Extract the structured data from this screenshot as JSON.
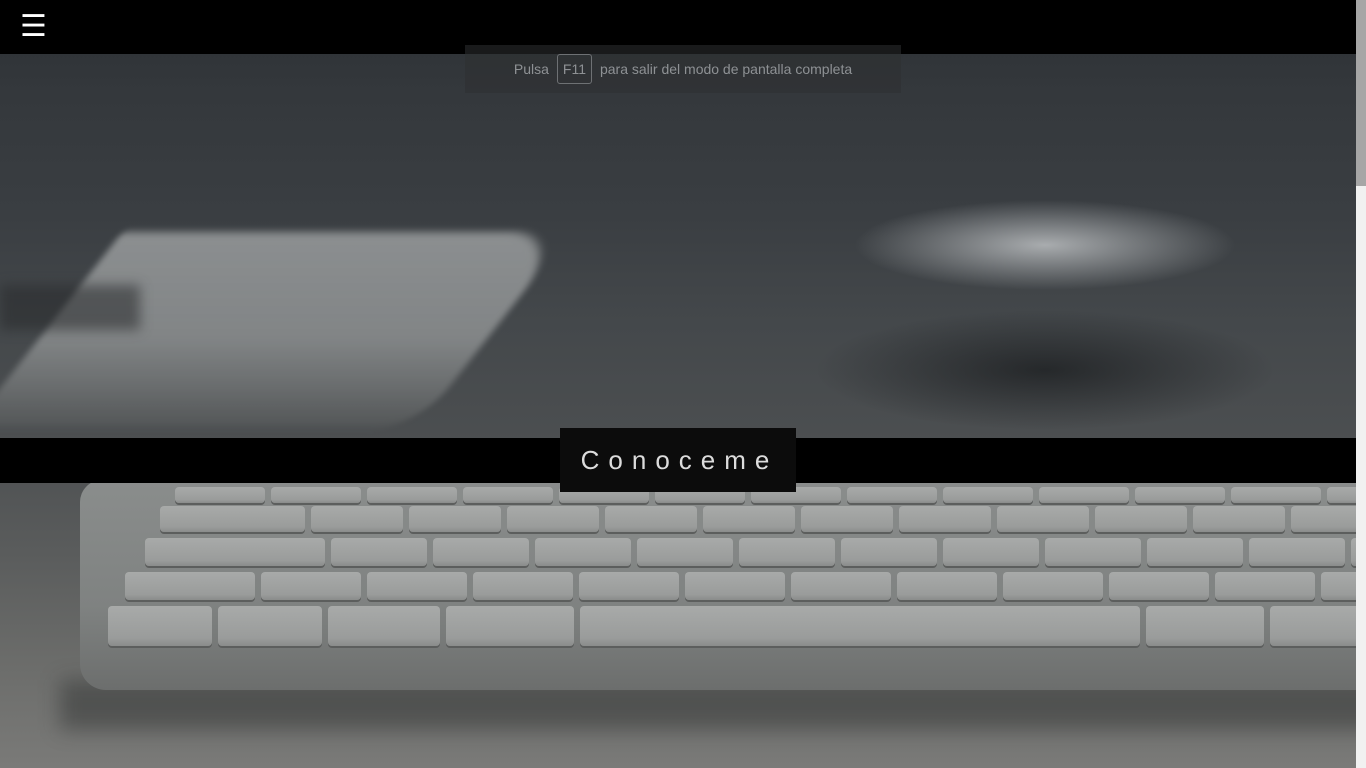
{
  "nav": {
    "menu_icon": "hamburger-menu-icon",
    "menu_glyph": "☰"
  },
  "fullscreen_notice": {
    "prefix": "Pulsa",
    "key": "F11",
    "suffix": "para salir del modo de pantalla completa"
  },
  "hero": {
    "cta_label": "Conoceme"
  },
  "colors": {
    "topbar": "#000000",
    "band": "#000000",
    "cta_background": "#0c0c0c",
    "cta_text": "#dcdcdc"
  }
}
